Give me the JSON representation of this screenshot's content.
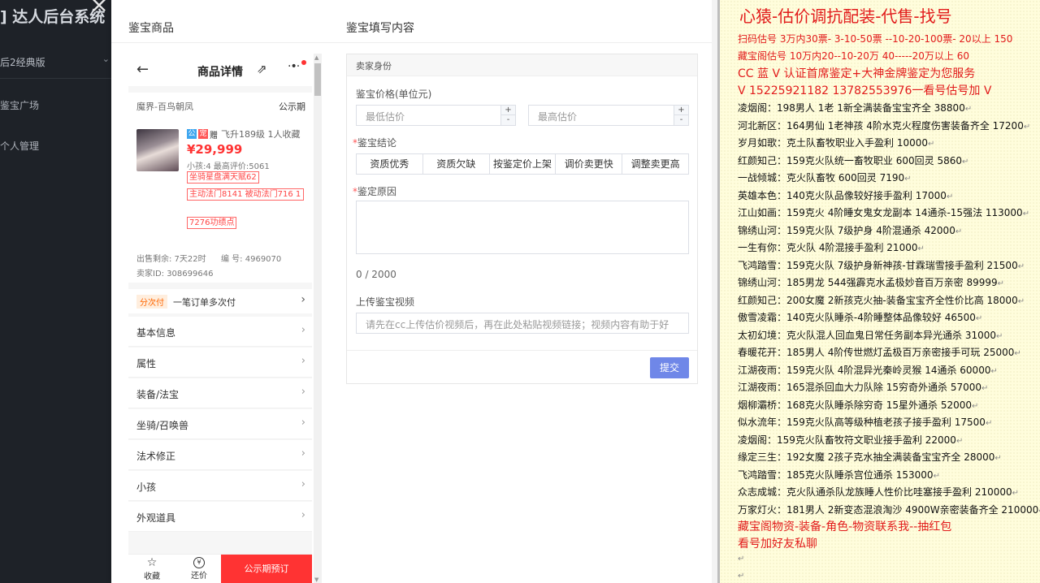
{
  "sidebar": {
    "logo": "] 达人后台系统",
    "version": "后2经典版",
    "nav": [
      "鉴宝广场",
      "个人管理"
    ]
  },
  "modal": {
    "left_title": "鉴宝商品",
    "right_title": "鉴宝填写内容"
  },
  "phone": {
    "title": "商品详情",
    "server": "魔界-百鸟朝凤",
    "public_label": "公示期",
    "tag_icons": [
      "公",
      "宠",
      "赠"
    ],
    "level_info": "飞升189级 1人收藏",
    "price": "¥29,999",
    "kid_info": "小孩:4 最高评价:5061",
    "red_tags": [
      "坐骑星盘满天赋62",
      "主动法门8141 被动法门716 1",
      "7276功绩点"
    ],
    "sale_remaining": "出售剩余: 7天22时",
    "code": "编 号: 4969070",
    "seller_id": "卖家ID: 308699646",
    "pay_badge": "分次付",
    "pay_text": "一笔订单多次付",
    "menu": [
      "基本信息",
      "属性",
      "装备/法宝",
      "坐骑/召唤兽",
      "法术修正",
      "小孩",
      "外观道具"
    ],
    "bottom": {
      "fav": "收藏",
      "bargain": "还价",
      "bargain_icon": "¥",
      "order": "公示期预订"
    }
  },
  "form": {
    "section": "卖家身份",
    "price_label": "鉴宝价格(单位元)",
    "min_placeholder": "最低估价",
    "max_placeholder": "最高估价",
    "conclusion_label": "鉴宝结论",
    "options": [
      "资质优秀",
      "资质欠缺",
      "按鉴定价上架",
      "调价卖更快",
      "调整卖更高"
    ],
    "reason_label": "鉴定原因",
    "counter": "0 / 2000",
    "video_label": "上传鉴宝视频",
    "video_placeholder": "请先在cc上传估价视频后，再在此处粘贴视频链接；视频内容有助于好",
    "submit": "提交"
  },
  "notes": {
    "headline": "心猿-估价调抗配装-代售-找号",
    "red_lines": [
      "扫码估号 3万内30票- 3-10-50票  --10-20-100票- 20以上 150",
      "藏宝阁估号 10万内20--10-20万 40-----20万以上 60",
      "CC 蓝 V 认证首席鉴定+大神金牌鉴定为您服务",
      "V 15225921182      13782553976一看号估号加 V"
    ],
    "entries": [
      {
        "name": "凌烟阁",
        "text": "198男人 1老 1新全满装备宝宝齐全 38800"
      },
      {
        "name": "河北新区",
        "text": "164男仙 1老神孩 4阶水克火程度伤害装备齐全 17200"
      },
      {
        "name": "岁月如歌",
        "text": "克土队畜牧职业入手盈利 10000"
      },
      {
        "name": "红颜知己",
        "text": "159克火队统一畜牧职业 600回灵 5860"
      },
      {
        "name": "一战倾城",
        "text": "克火队畜牧 600回灵 7190"
      },
      {
        "name": "英雄本色",
        "text": "140克火队品像较好接手盈利 17000"
      },
      {
        "name": "江山如画",
        "text": "159克火 4阶睡女鬼女龙副本 14通杀-15强法 113000"
      },
      {
        "name": "锦绣山河",
        "text": "159克火队 7级护身 4阶混通杀 42000"
      },
      {
        "name": "一生有你",
        "text": "克火队 4阶混接手盈利 21000"
      },
      {
        "name": "飞鸿踏雪",
        "text": "159克火队 7级护身新神孩-甘霖瑞雪接手盈利 21500"
      },
      {
        "name": "锦绣山河",
        "text": "185男龙 544强霹克水孟极妙音百万亲密 89999"
      },
      {
        "name": "红颜知己",
        "text": "200女魔 2新孩克火抽-装备宝宝齐全性价比高 18000"
      },
      {
        "name": "傲雪凌霜",
        "text": "140克火队睡杀-4阶睡整体品像较好 46500"
      },
      {
        "name": "太初幻境",
        "text": "克火队混人回血鬼日常任务副本异光通杀 31000"
      },
      {
        "name": "春暖花开",
        "text": "185男人 4阶传世燃灯孟极百万亲密接手可玩 25000"
      },
      {
        "name": "江湖夜雨",
        "text": "159克火队 4阶混异光秦岭灵猴 14通杀 60000"
      },
      {
        "name": "江湖夜雨",
        "text": "165混杀回血大力队除 15穷奇外通杀 57000"
      },
      {
        "name": "烟柳灞桥",
        "text": "168克火队睡杀除穷奇 15星外通杀 52000"
      },
      {
        "name": "似水流年",
        "text": "159克火队高等级种植老孩子接手盈利 17500"
      },
      {
        "name": "凌烟阁",
        "text": "159克火队畜牧符文职业接手盈利 22000"
      },
      {
        "name": "缘定三生",
        "text": "192女魔 2孩子克水抽全满装备宝宝齐全 28000"
      },
      {
        "name": "飞鸿踏雪",
        "text": "185克火队睡杀宫位通杀 153000"
      },
      {
        "name": "众志成城",
        "text": "克火队通杀队龙族睡人性价比哇塞接手盈利 210000"
      },
      {
        "name": "万家灯火",
        "text": "181男人 2新变态混浪淘沙 4900W亲密装备齐全 210000"
      }
    ],
    "footer_lines": [
      "藏宝阁物资-装备-角色-物资联系我--抽红包",
      "看号加好友私聊"
    ]
  },
  "colors": {
    "sidebar_bg": "#1e2228",
    "accent_red": "#f33",
    "submit_blue": "#6f87e8",
    "notes_bg": "#fffddc",
    "notes_red": "#e21b1b"
  }
}
